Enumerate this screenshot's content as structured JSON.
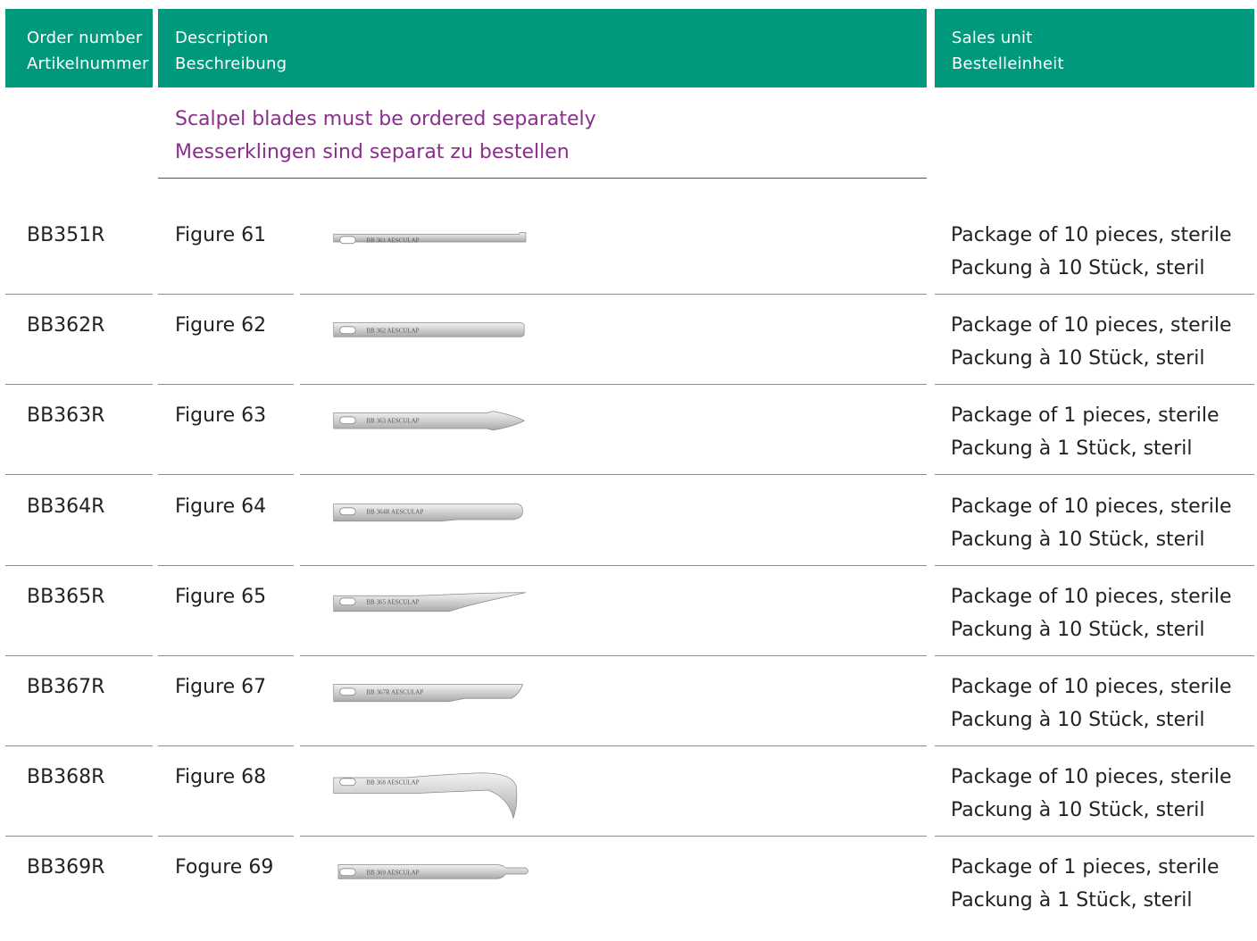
{
  "header": {
    "order": {
      "line1": "Order number",
      "line2": "Artikelnummer"
    },
    "description": {
      "line1": "Description",
      "line2": "Beschreibung"
    },
    "sales": {
      "line1": "Sales unit",
      "line2": "Bestelleinheit"
    }
  },
  "colors": {
    "header_bg": "#00997c",
    "note_text": "#8a2d8d",
    "header_text": "#ffffff"
  },
  "note": {
    "line1": "Scalpel blades must be ordered separately",
    "line2": "Messerklingen sind separat zu bestellen"
  },
  "rows": [
    {
      "order": "BB351R",
      "figure": "Figure 61",
      "blade_label": "BB 361 AESCULAP",
      "blade_icon": "straight-blade",
      "sales1": "Package of 10 pieces, sterile",
      "sales2": "Packung à 10 Stück, steril"
    },
    {
      "order": "BB362R",
      "figure": "Figure 62",
      "blade_label": "BB 362 AESCULAP",
      "blade_icon": "flat-blade",
      "sales1": "Package of 10 pieces, sterile",
      "sales2": "Packung à 10 Stück, steril"
    },
    {
      "order": "BB363R",
      "figure": "Figure 63",
      "blade_label": "BB 363 AESCULAP",
      "blade_icon": "pointed-blade",
      "sales1": "Package of 1 pieces, sterile",
      "sales2": "Packung à 1 Stück, steril"
    },
    {
      "order": "BB364R",
      "figure": "Figure 64",
      "blade_label": "BB 364R AESCULAP",
      "blade_icon": "rounded-blade",
      "sales1": "Package of 10 pieces, sterile",
      "sales2": "Packung à 10 Stück, steril"
    },
    {
      "order": "BB365R",
      "figure": "Figure 65",
      "blade_label": "BB 365 AESCULAP",
      "blade_icon": "angled-blade",
      "sales1": "Package of 10 pieces, sterile",
      "sales2": "Packung à 10 Stück, steril"
    },
    {
      "order": "BB367R",
      "figure": "Figure 67",
      "blade_label": "BB 367R AESCULAP",
      "blade_icon": "beaver-blade",
      "sales1": "Package of 10 pieces, sterile",
      "sales2": "Packung à 10 Stück, steril"
    },
    {
      "order": "BB368R",
      "figure": "Figure 68",
      "blade_label": "BB 368 AESCULAP",
      "blade_icon": "curved-blade",
      "sales1": "Package of 10 pieces, sterile",
      "sales2": "Packung à 10 Stück, steril"
    },
    {
      "order": "BB369R",
      "figure": "Fogure 69",
      "blade_label": "BB 369 AESCULAP",
      "blade_icon": "hook-blade",
      "sales1": "Package of 1 pieces, sterile",
      "sales2": "Packung à 1 Stück, steril"
    }
  ]
}
